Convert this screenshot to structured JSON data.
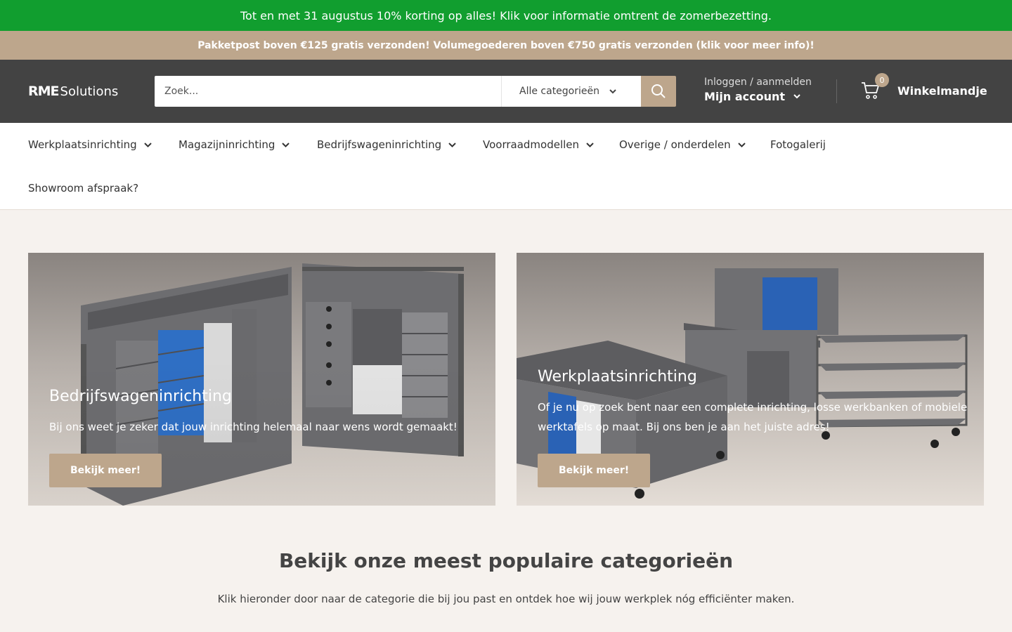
{
  "announcement": "Tot en met 31 augustus 10% korting op alles! Klik voor informatie omtrent de zomerbezetting.",
  "shipping": "Pakketpost boven €125 gratis verzonden! Volumegoederen boven €750 gratis verzonden (klik voor meer info)!",
  "header": {
    "logo_main": "RME",
    "logo_sub": "Solutions",
    "search_placeholder": "Zoek...",
    "search_category": "Alle categorieën",
    "account_small": "Inloggen / aanmelden",
    "account_big": "Mijn account",
    "cart_count": "0",
    "cart_label": "Winkelmandje"
  },
  "nav": {
    "items": [
      "Werkplaatsinrichting",
      "Magazijninrichting",
      "Bedrijfswageninrichting",
      "Voorraadmodellen",
      "Overige / onderdelen",
      "Fotogalerij",
      "Showroom afspraak?"
    ]
  },
  "promos": [
    {
      "title": "Bedrijfswageninrichting",
      "text": "Bij ons weet je zeker dat jouw inrichting helemaal naar wens wordt gemaakt!",
      "button": "Bekijk meer!"
    },
    {
      "title": "Werkplaatsinrichting",
      "text": "Of je nu op zoek bent naar een complete inrichting, losse werkbanken of mobiele werktafels op maat. Bij ons ben je aan het juiste adres!",
      "button": "Bekijk meer!"
    }
  ],
  "categories": {
    "title": "Bekijk onze meest populaire categorieën",
    "subtitle": "Klik hieronder door naar de categorie die bij jou past en ontdek hoe wij jouw werkplek nóg efficiënter maken."
  },
  "colors": {
    "announcement_bg": "#119e2f",
    "accent": "#bda68c",
    "header_bg": "#434343"
  }
}
